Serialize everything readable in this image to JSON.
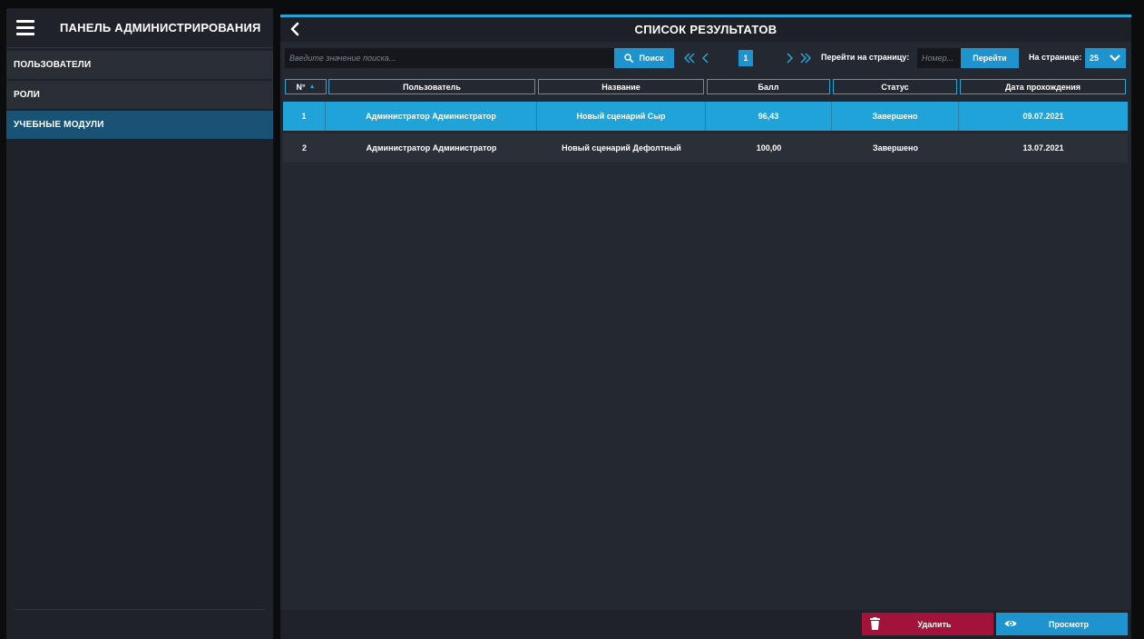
{
  "sidebar": {
    "title": "ПАНЕЛЬ АДМИНИСТРИРОВАНИЯ",
    "items": [
      {
        "label": "ПОЛЬЗОВАТЕЛИ"
      },
      {
        "label": "РОЛИ"
      },
      {
        "label": "УЧЕБНЫЕ МОДУЛИ"
      }
    ],
    "active_item": "УЧЕБНЫЕ МОДУЛИ"
  },
  "main": {
    "title": "СПИСОК РЕЗУЛЬТАТОВ",
    "search": {
      "placeholder": "Введите значение поиска...",
      "button_label": "Поиск"
    },
    "pagination": {
      "current_page": "1",
      "goto_label": "Перейти на страницу:",
      "goto_placeholder": "Номер...",
      "goto_button": "Перейти",
      "per_page_label": "На странице:",
      "per_page_value": "25"
    },
    "table": {
      "columns": [
        "N°",
        "Пользователь",
        "Название",
        "Балл",
        "Статус",
        "Дата прохождения"
      ],
      "rows": [
        {
          "num": "1",
          "user": "Администратор Администратор",
          "name": "Новый сценарий Сыр",
          "score": "96,43",
          "status": "Завершено",
          "date": "09.07.2021"
        },
        {
          "num": "2",
          "user": "Администратор Администратор",
          "name": "Новый сценарий Дефолтный",
          "score": "100,00",
          "status": "Завершено",
          "date": "13.07.2021"
        }
      ],
      "selected_row": "1"
    },
    "footer": {
      "delete_label": "Удалить",
      "view_label": "Просмотр"
    }
  },
  "colors": {
    "accent": "#1e93cd",
    "selected_row": "#1fa3d8",
    "delete": "#a3123a",
    "sidebar_active": "#1a5275"
  },
  "icons": [
    "hamburger-menu-icon",
    "back-arrow-icon",
    "search-icon",
    "first-page-icon",
    "prev-page-icon",
    "next-page-icon",
    "last-page-icon",
    "chevron-down-icon",
    "sort-asc-icon",
    "trash-icon",
    "eye-icon"
  ]
}
